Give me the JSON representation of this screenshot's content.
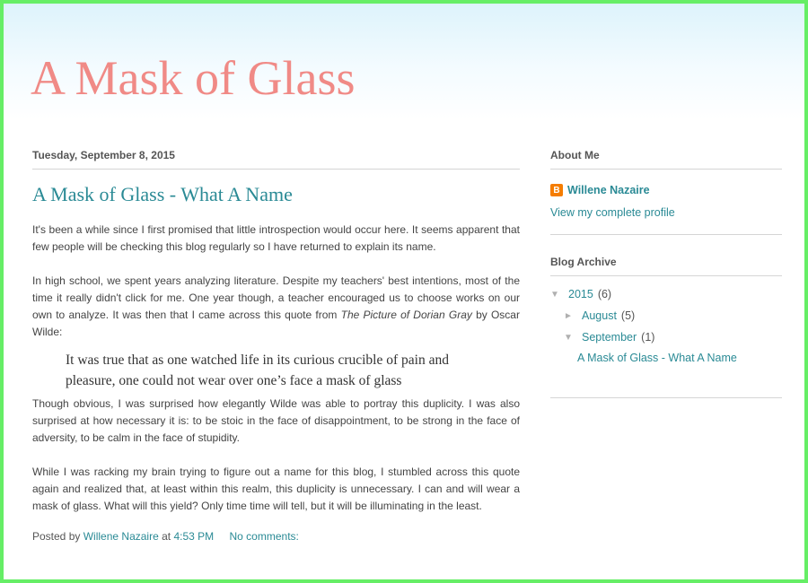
{
  "blog": {
    "title": "A Mask of Glass"
  },
  "post": {
    "date": "Tuesday, September 8, 2015",
    "title": "A Mask of Glass - What A Name",
    "paragraphs": [
      "It's been a while since I first promised that little introspection would occur here. It seems apparent that few people will be checking this blog regularly so I have returned to explain its name.",
      "In high school, we spent years analyzing literature. Despite my teachers' best intentions, most of the time it really didn't click for me. One year though, a teacher encouraged us to choose works on our own to analyze. It was then that I came across this quote from ",
      "Though obvious, I was surprised how elegantly Wilde was able to portray this duplicity. I was also surprised at how necessary it is: to be stoic in the face of disappointment, to be strong in the face of adversity, to be calm in the face of stupidity.",
      "While I was racking my brain trying to figure out a name for this blog, I stumbled across this quote again and realized that, at least within this realm, this duplicity is unnecessary. I can and will wear a mask of glass. What will this yield? Only time time will tell, but it will be illuminating in the least."
    ],
    "book_title": "The Picture of Dorian Gray",
    "book_suffix": " by Oscar Wilde:",
    "quote": "It was true that as one watched life in its curious crucible of pain and pleasure, one could not wear over one’s face a mask of glass",
    "footer": {
      "posted_by": "Posted by",
      "author": "Willene Nazaire",
      "at": "at",
      "time": "4:53 PM",
      "comments": "No comments:"
    }
  },
  "sidebar": {
    "about": {
      "title": "About Me",
      "name": "Willene Nazaire",
      "profile_link": "View my complete profile",
      "icon": "blogger-icon"
    },
    "archive": {
      "title": "Blog Archive",
      "year": {
        "label": "2015",
        "count": "(6)",
        "toggle": "▼"
      },
      "months": [
        {
          "label": "August",
          "count": "(5)",
          "toggle": "►"
        },
        {
          "label": "September",
          "count": "(1)",
          "toggle": "▼"
        }
      ],
      "posts": [
        "A Mask of Glass - What A Name"
      ]
    }
  },
  "colors": {
    "frame_border": "#66ee66",
    "title": "#f08a86",
    "link": "#2a8a95",
    "text": "#444444"
  }
}
